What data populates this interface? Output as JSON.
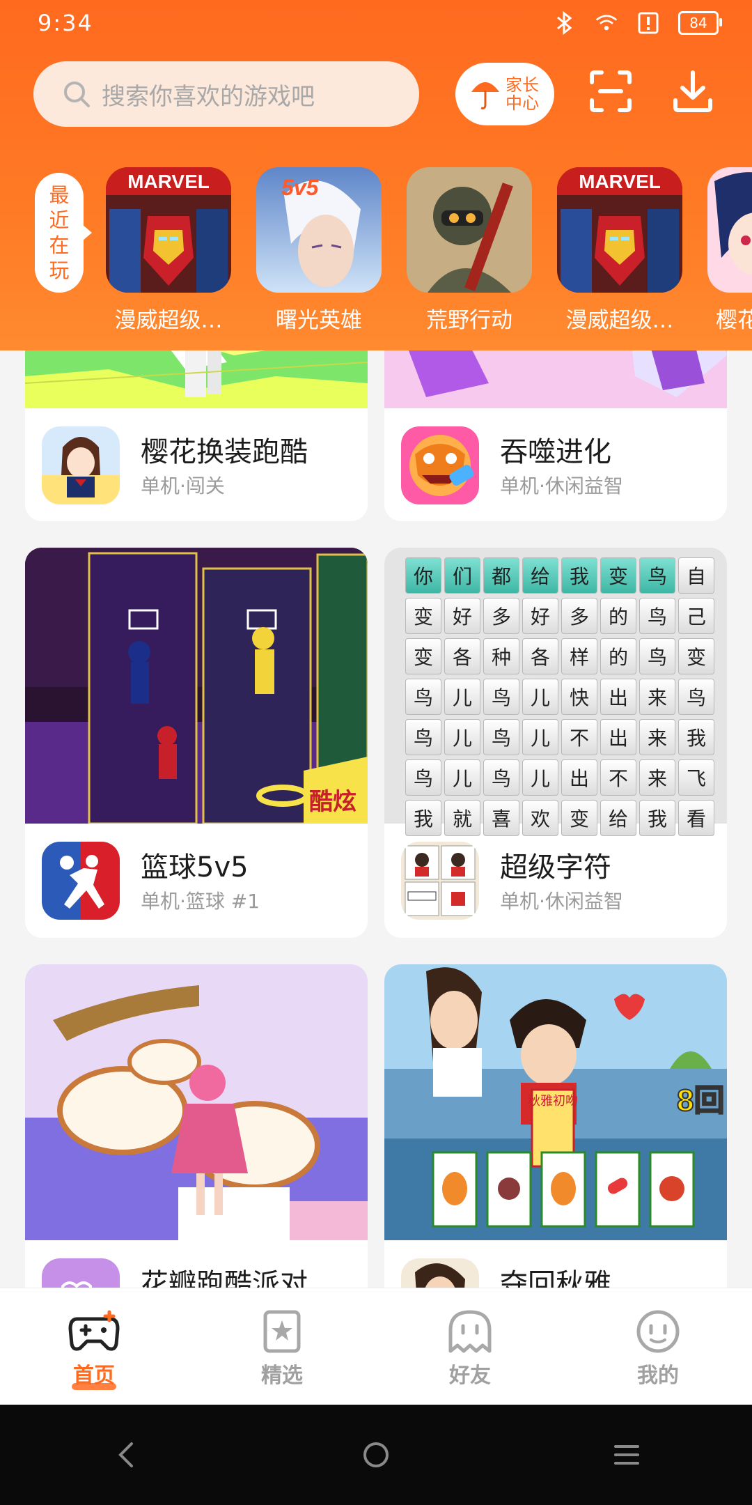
{
  "status": {
    "time": "9:34",
    "battery": "84"
  },
  "search": {
    "placeholder": "搜索你喜欢的游戏吧"
  },
  "parent_center": {
    "line1": "家长",
    "line2": "中心"
  },
  "recent": {
    "tag": [
      "最",
      "近",
      "在",
      "玩"
    ],
    "items": [
      {
        "name": "漫威超级…"
      },
      {
        "name": "曙光英雄"
      },
      {
        "name": "荒野行动"
      },
      {
        "name": "漫威超级…"
      },
      {
        "name": "樱花"
      }
    ]
  },
  "feed": [
    {
      "title": "樱花换装跑酷",
      "sub": "单机·闯关"
    },
    {
      "title": "吞噬进化",
      "sub": "单机·休闲益智"
    },
    {
      "title": "篮球5v5",
      "sub": "单机·篮球  #1"
    },
    {
      "title": "超级字符",
      "sub": "单机·休闲益智"
    },
    {
      "title": "花瓣跑酷派对",
      "sub": ""
    },
    {
      "title": "夺回秋雅",
      "sub": ""
    }
  ],
  "banner_text": {
    "basketball_tag": "酷炫",
    "card_title": "秋雅初吻",
    "combo": "8回"
  },
  "word_grid": [
    [
      "你",
      "们",
      "都",
      "给",
      "我",
      "变",
      "鸟",
      "自"
    ],
    [
      "变",
      "好",
      "多",
      "好",
      "多",
      "的",
      "鸟",
      "己"
    ],
    [
      "变",
      "各",
      "种",
      "各",
      "样",
      "的",
      "鸟",
      "变"
    ],
    [
      "鸟",
      "儿",
      "鸟",
      "儿",
      "快",
      "出",
      "来",
      "鸟"
    ],
    [
      "鸟",
      "儿",
      "鸟",
      "儿",
      "不",
      "出",
      "来",
      "我"
    ],
    [
      "鸟",
      "儿",
      "鸟",
      "儿",
      "出",
      "不",
      "来",
      "飞"
    ],
    [
      "我",
      "就",
      "喜",
      "欢",
      "变",
      "给",
      "我",
      "看"
    ]
  ],
  "nav": [
    {
      "label": "首页",
      "icon": "gamepad-icon",
      "active": true
    },
    {
      "label": "精选",
      "icon": "star-bookmark-icon",
      "active": false
    },
    {
      "label": "好友",
      "icon": "ghost-icon",
      "active": false
    },
    {
      "label": "我的",
      "icon": "smiley-face-icon",
      "active": false
    }
  ],
  "colors": {
    "accent": "#ff6a1f",
    "background": "#f4f4f4"
  }
}
